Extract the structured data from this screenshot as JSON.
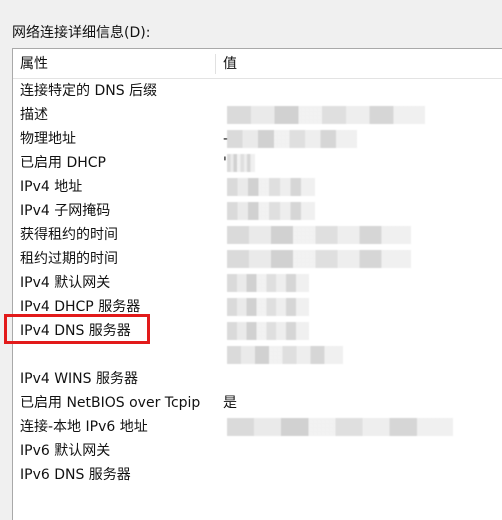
{
  "panel_label": "网络连接详细信息(D):",
  "columns": {
    "property": "属性",
    "value": "值"
  },
  "rows": [
    {
      "property": "连接特定的 DNS 后缀",
      "value": ""
    },
    {
      "property": "描述",
      "value": ""
    },
    {
      "property": "物理地址",
      "value": "-"
    },
    {
      "property": "已启用 DHCP",
      "value": "'"
    },
    {
      "property": "IPv4 地址",
      "value": ""
    },
    {
      "property": "IPv4 子网掩码",
      "value": ""
    },
    {
      "property": "获得租约的时间",
      "value": ""
    },
    {
      "property": "租约过期的时间",
      "value": ""
    },
    {
      "property": "IPv4 默认网关",
      "value": ""
    },
    {
      "property": "IPv4 DHCP 服务器",
      "value": ""
    },
    {
      "property": "IPv4 DNS 服务器",
      "value": ""
    },
    {
      "property": "",
      "value": ""
    },
    {
      "property": "IPv4 WINS 服务器",
      "value": ""
    },
    {
      "property": "已启用 NetBIOS over Tcpip",
      "value": "是"
    },
    {
      "property": "连接-本地 IPv6 地址",
      "value": ""
    },
    {
      "property": "IPv6 默认网关",
      "value": ""
    },
    {
      "property": "IPv6 DNS 服务器",
      "value": ""
    }
  ],
  "annotation": {
    "highlight_color": "#e21a1a",
    "highlighted_property": "IPv4 DNS 服务器"
  }
}
